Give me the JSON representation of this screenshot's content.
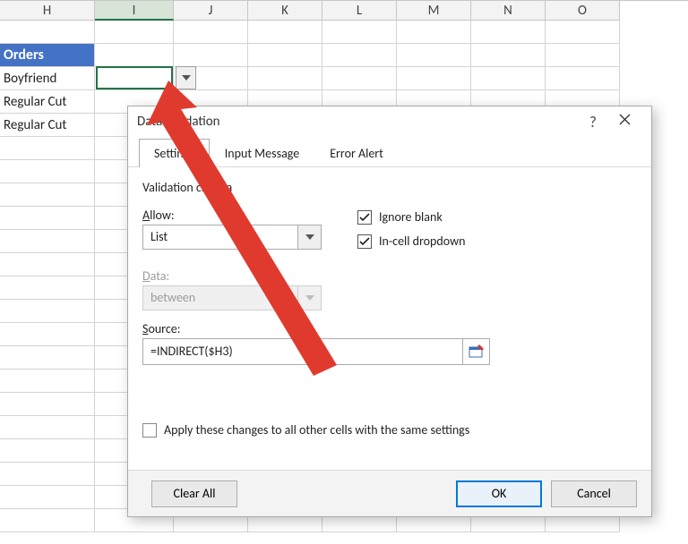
{
  "columns": [
    "H",
    "I",
    "J",
    "K",
    "L",
    "M",
    "N",
    "O"
  ],
  "selectedColumn": "I",
  "rows": {
    "header": "Orders",
    "r2": "Boyfriend",
    "r3": "Regular Cut",
    "r4": "Regular Cut"
  },
  "dialog": {
    "title": "Data Validation",
    "help": "?",
    "tabs": {
      "settings": "Settings",
      "input": "Input Message",
      "error": "Error Alert"
    },
    "criteria_label": "Validation criteria",
    "allow_label": "Allow:",
    "allow_value": "List",
    "data_label": "Data:",
    "data_value": "between",
    "ignore_blank": "Ignore blank",
    "incell_dd": "In-cell dropdown",
    "source_label": "Source:",
    "source_value": "=INDIRECT($H3)",
    "apply_label": "Apply these changes to all other cells with the same settings",
    "clear_all": "Clear All",
    "ok": "OK",
    "cancel": "Cancel"
  }
}
